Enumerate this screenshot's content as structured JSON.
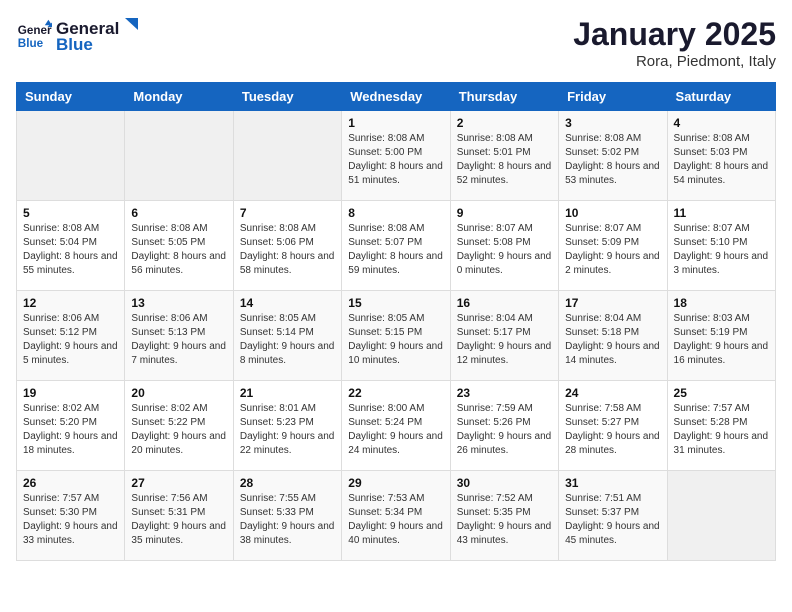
{
  "logo": {
    "general": "General",
    "blue": "Blue"
  },
  "title": "January 2025",
  "location": "Rora, Piedmont, Italy",
  "days_of_week": [
    "Sunday",
    "Monday",
    "Tuesday",
    "Wednesday",
    "Thursday",
    "Friday",
    "Saturday"
  ],
  "weeks": [
    [
      {
        "day": "",
        "info": ""
      },
      {
        "day": "",
        "info": ""
      },
      {
        "day": "",
        "info": ""
      },
      {
        "day": "1",
        "info": "Sunrise: 8:08 AM\nSunset: 5:00 PM\nDaylight: 8 hours and 51 minutes."
      },
      {
        "day": "2",
        "info": "Sunrise: 8:08 AM\nSunset: 5:01 PM\nDaylight: 8 hours and 52 minutes."
      },
      {
        "day": "3",
        "info": "Sunrise: 8:08 AM\nSunset: 5:02 PM\nDaylight: 8 hours and 53 minutes."
      },
      {
        "day": "4",
        "info": "Sunrise: 8:08 AM\nSunset: 5:03 PM\nDaylight: 8 hours and 54 minutes."
      }
    ],
    [
      {
        "day": "5",
        "info": "Sunrise: 8:08 AM\nSunset: 5:04 PM\nDaylight: 8 hours and 55 minutes."
      },
      {
        "day": "6",
        "info": "Sunrise: 8:08 AM\nSunset: 5:05 PM\nDaylight: 8 hours and 56 minutes."
      },
      {
        "day": "7",
        "info": "Sunrise: 8:08 AM\nSunset: 5:06 PM\nDaylight: 8 hours and 58 minutes."
      },
      {
        "day": "8",
        "info": "Sunrise: 8:08 AM\nSunset: 5:07 PM\nDaylight: 8 hours and 59 minutes."
      },
      {
        "day": "9",
        "info": "Sunrise: 8:07 AM\nSunset: 5:08 PM\nDaylight: 9 hours and 0 minutes."
      },
      {
        "day": "10",
        "info": "Sunrise: 8:07 AM\nSunset: 5:09 PM\nDaylight: 9 hours and 2 minutes."
      },
      {
        "day": "11",
        "info": "Sunrise: 8:07 AM\nSunset: 5:10 PM\nDaylight: 9 hours and 3 minutes."
      }
    ],
    [
      {
        "day": "12",
        "info": "Sunrise: 8:06 AM\nSunset: 5:12 PM\nDaylight: 9 hours and 5 minutes."
      },
      {
        "day": "13",
        "info": "Sunrise: 8:06 AM\nSunset: 5:13 PM\nDaylight: 9 hours and 7 minutes."
      },
      {
        "day": "14",
        "info": "Sunrise: 8:05 AM\nSunset: 5:14 PM\nDaylight: 9 hours and 8 minutes."
      },
      {
        "day": "15",
        "info": "Sunrise: 8:05 AM\nSunset: 5:15 PM\nDaylight: 9 hours and 10 minutes."
      },
      {
        "day": "16",
        "info": "Sunrise: 8:04 AM\nSunset: 5:17 PM\nDaylight: 9 hours and 12 minutes."
      },
      {
        "day": "17",
        "info": "Sunrise: 8:04 AM\nSunset: 5:18 PM\nDaylight: 9 hours and 14 minutes."
      },
      {
        "day": "18",
        "info": "Sunrise: 8:03 AM\nSunset: 5:19 PM\nDaylight: 9 hours and 16 minutes."
      }
    ],
    [
      {
        "day": "19",
        "info": "Sunrise: 8:02 AM\nSunset: 5:20 PM\nDaylight: 9 hours and 18 minutes."
      },
      {
        "day": "20",
        "info": "Sunrise: 8:02 AM\nSunset: 5:22 PM\nDaylight: 9 hours and 20 minutes."
      },
      {
        "day": "21",
        "info": "Sunrise: 8:01 AM\nSunset: 5:23 PM\nDaylight: 9 hours and 22 minutes."
      },
      {
        "day": "22",
        "info": "Sunrise: 8:00 AM\nSunset: 5:24 PM\nDaylight: 9 hours and 24 minutes."
      },
      {
        "day": "23",
        "info": "Sunrise: 7:59 AM\nSunset: 5:26 PM\nDaylight: 9 hours and 26 minutes."
      },
      {
        "day": "24",
        "info": "Sunrise: 7:58 AM\nSunset: 5:27 PM\nDaylight: 9 hours and 28 minutes."
      },
      {
        "day": "25",
        "info": "Sunrise: 7:57 AM\nSunset: 5:28 PM\nDaylight: 9 hours and 31 minutes."
      }
    ],
    [
      {
        "day": "26",
        "info": "Sunrise: 7:57 AM\nSunset: 5:30 PM\nDaylight: 9 hours and 33 minutes."
      },
      {
        "day": "27",
        "info": "Sunrise: 7:56 AM\nSunset: 5:31 PM\nDaylight: 9 hours and 35 minutes."
      },
      {
        "day": "28",
        "info": "Sunrise: 7:55 AM\nSunset: 5:33 PM\nDaylight: 9 hours and 38 minutes."
      },
      {
        "day": "29",
        "info": "Sunrise: 7:53 AM\nSunset: 5:34 PM\nDaylight: 9 hours and 40 minutes."
      },
      {
        "day": "30",
        "info": "Sunrise: 7:52 AM\nSunset: 5:35 PM\nDaylight: 9 hours and 43 minutes."
      },
      {
        "day": "31",
        "info": "Sunrise: 7:51 AM\nSunset: 5:37 PM\nDaylight: 9 hours and 45 minutes."
      },
      {
        "day": "",
        "info": ""
      }
    ]
  ]
}
